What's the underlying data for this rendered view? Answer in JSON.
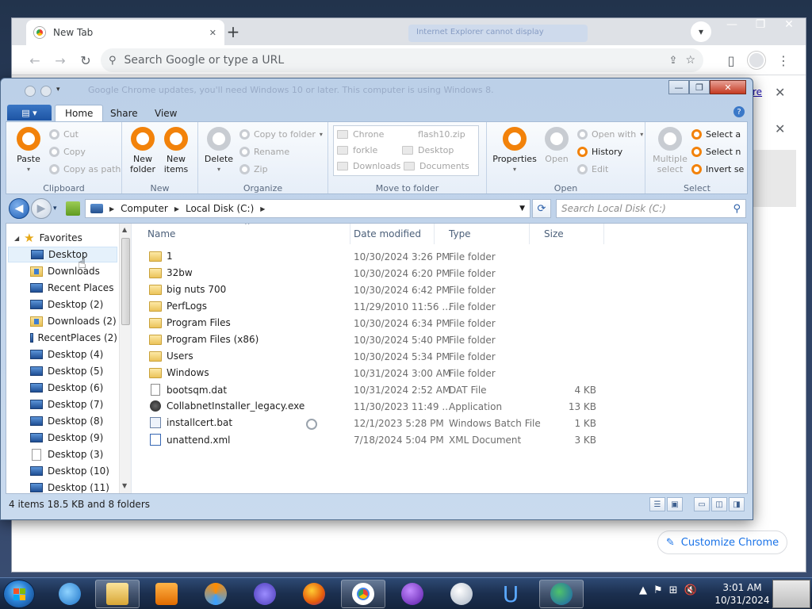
{
  "chrome": {
    "tab_title": "New Tab",
    "tab_close": "✕",
    "new_tab": "+",
    "ghost_tab": "Internet Explorer cannot display",
    "window_controls": {
      "minimize": "—",
      "restore": "❐",
      "close": "✕"
    },
    "back": "←",
    "forward": "→",
    "reload": "↻",
    "omnibox_placeholder": "Search Google or type a URL",
    "side_close_1": "✕",
    "side_close_2": "✕",
    "link_text": "re",
    "customize_label": "Customize Chrome"
  },
  "explorer": {
    "ghost_title": "Google Chrome updates, you'll need Windows 10 or later. This computer is using Windows 8.",
    "window_controls": {
      "minimize": "—",
      "maximize": "❐",
      "close": "✕"
    },
    "ribbon_tabs": {
      "file": "▤ ▾",
      "home": "Home",
      "share": "Share",
      "view": "View"
    },
    "help": "?",
    "clipboard": {
      "label": "Clipboard",
      "paste": "Paste",
      "cut": "Cut",
      "copy": "Copy",
      "copy_as_path": "Copy as path"
    },
    "new": {
      "label": "New",
      "new_folder": "New folder",
      "new_items": "New items"
    },
    "organize": {
      "label": "Organize",
      "delete": "Delete",
      "copy_to_folder": "Copy to folder",
      "rename": "Rename",
      "zip": "Zip"
    },
    "move_to_folder": {
      "label": "Move to folder",
      "items": [
        "Chrone",
        "flash10.zip",
        "forkle",
        "Desktop",
        "Downloads",
        "Documents"
      ]
    },
    "open": {
      "label": "Open",
      "properties": "Properties",
      "open": "Open",
      "open_with": "Open with",
      "history": "History",
      "edit": "Edit"
    },
    "select": {
      "label": "Select",
      "multiple_select": "Multiple select",
      "select_all": "Select a",
      "select_none": "Select n",
      "invert": "Invert se"
    },
    "address": {
      "computer": "Computer",
      "local_disk": "Local Disk (C:)"
    },
    "search_placeholder": "Search Local Disk (C:)",
    "nav": {
      "favorites": "Favorites",
      "items": [
        "Desktop",
        "Downloads",
        "Recent Places",
        "Desktop (2)",
        "Downloads (2)",
        "RecentPlaces (2)",
        "Desktop (4)",
        "Desktop (5)",
        "Desktop (6)",
        "Desktop (7)",
        "Desktop (8)",
        "Desktop (9)",
        "Desktop (3)",
        "Desktop (10)",
        "Desktop (11)"
      ]
    },
    "columns": {
      "name": "Name",
      "date": "Date modified",
      "type": "Type",
      "size": "Size"
    },
    "files": [
      {
        "name": "1",
        "date": "10/30/2024 3:26 PM",
        "type": "File folder",
        "size": ""
      },
      {
        "name": "32bw",
        "date": "10/30/2024 6:20 PM",
        "type": "File folder",
        "size": ""
      },
      {
        "name": "big nuts 700",
        "date": "10/30/2024 6:42 PM",
        "type": "File folder",
        "size": ""
      },
      {
        "name": "PerfLogs",
        "date": "11/29/2010 11:56 ...",
        "type": "File folder",
        "size": ""
      },
      {
        "name": "Program Files",
        "date": "10/30/2024 6:34 PM",
        "type": "File folder",
        "size": ""
      },
      {
        "name": "Program Files (x86)",
        "date": "10/30/2024 5:40 PM",
        "type": "File folder",
        "size": ""
      },
      {
        "name": "Users",
        "date": "10/30/2024 5:34 PM",
        "type": "File folder",
        "size": ""
      },
      {
        "name": "Windows",
        "date": "10/31/2024 3:00 AM",
        "type": "File folder",
        "size": ""
      },
      {
        "name": "bootsqm.dat",
        "date": "10/31/2024 2:52 AM",
        "type": "DAT File",
        "size": "4 KB"
      },
      {
        "name": "CollabnetInstaller_legacy.exe",
        "date": "11/30/2023 11:49 ...",
        "type": "Application",
        "size": "13 KB"
      },
      {
        "name": "installcert.bat",
        "date": "12/1/2023 5:28 PM",
        "type": "Windows Batch File",
        "size": "1 KB"
      },
      {
        "name": "unattend.xml",
        "date": "7/18/2024 5:04 PM",
        "type": "XML Document",
        "size": "3 KB"
      }
    ],
    "status": "4 items 18.5 KB and 8 folders"
  },
  "taskbar": {
    "clock_time": "3:01 AM",
    "clock_date": "10/31/2024"
  },
  "colors": {
    "accent_orange": "#f2820a",
    "explorer_frame": "#bcd0e8",
    "taskbar": "#1b2f4f"
  }
}
